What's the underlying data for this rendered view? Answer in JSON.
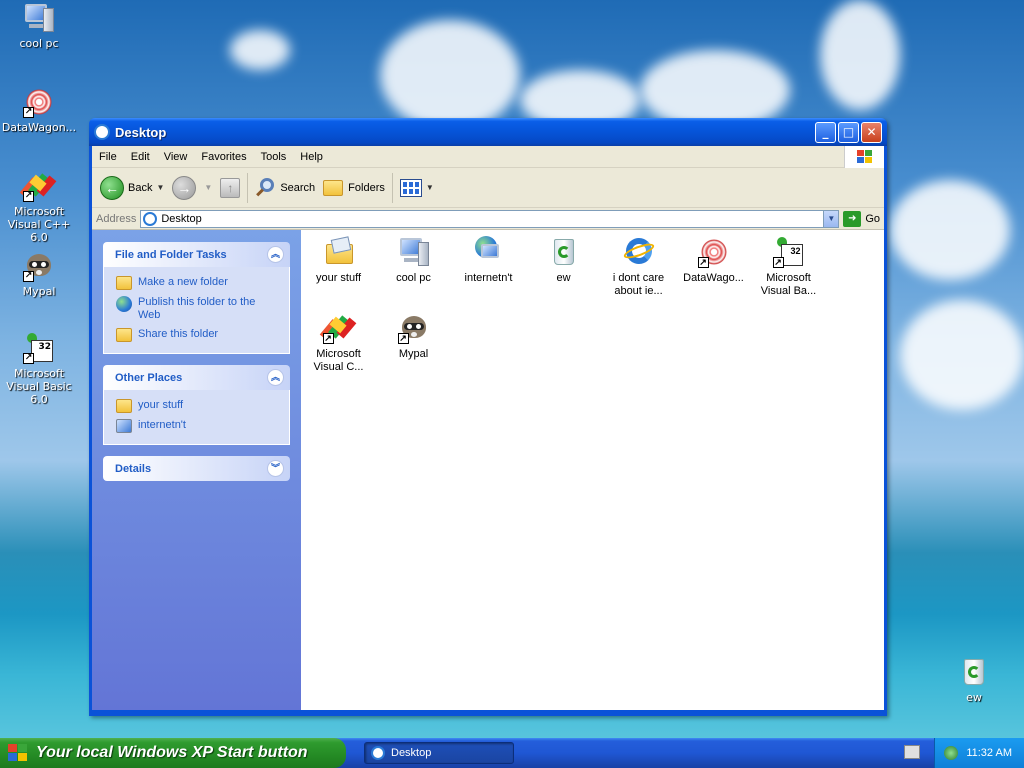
{
  "desktop": {
    "icons": [
      {
        "label": "cool pc"
      },
      {
        "label": "DataWagon..."
      },
      {
        "label": "Microsoft Visual C++ 6.0"
      },
      {
        "label": "Mypal"
      },
      {
        "label": "Microsoft Visual Basic 6.0"
      },
      {
        "label": "ew"
      }
    ]
  },
  "window": {
    "title": "Desktop",
    "menu": [
      "File",
      "Edit",
      "View",
      "Favorites",
      "Tools",
      "Help"
    ],
    "toolbar": {
      "back_label": "Back",
      "search_label": "Search",
      "folders_label": "Folders"
    },
    "address": {
      "label": "Address",
      "value": "Desktop",
      "go_label": "Go"
    },
    "taskpane": {
      "file_tasks": {
        "title": "File and Folder Tasks",
        "items": [
          "Make a new folder",
          "Publish this folder to the Web",
          "Share this folder"
        ]
      },
      "other_places": {
        "title": "Other Places",
        "items": [
          "your stuff",
          "internetn't"
        ]
      },
      "details": {
        "title": "Details"
      }
    },
    "files": [
      {
        "label": "your stuff"
      },
      {
        "label": "cool pc"
      },
      {
        "label": "internetn't"
      },
      {
        "label": "ew"
      },
      {
        "label": "i dont care about ie..."
      },
      {
        "label": "DataWago..."
      },
      {
        "label": "Microsoft Visual Ba..."
      },
      {
        "label": "Microsoft Visual C..."
      },
      {
        "label": "Mypal"
      }
    ]
  },
  "taskbar": {
    "start_label": "Your local Windows XP Start button",
    "task_label": "Desktop",
    "clock": "11:32 AM"
  }
}
